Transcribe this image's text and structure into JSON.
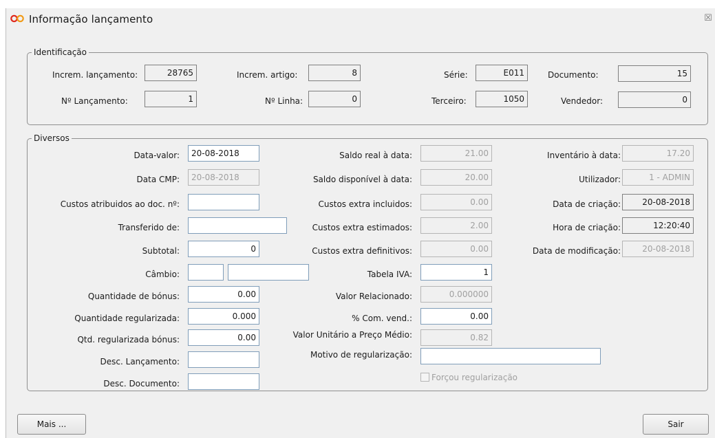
{
  "window": {
    "title": "Informação lançamento",
    "close_glyph": "☒"
  },
  "identificacao": {
    "legend": "Identificação",
    "increm_lancamento": {
      "label": "Increm. lançamento:",
      "value": "28765"
    },
    "increm_artigo": {
      "label": "Increm. artigo:",
      "value": "8"
    },
    "serie": {
      "label": "Série:",
      "value": "E011"
    },
    "documento": {
      "label": "Documento:",
      "value": "15"
    },
    "n_lancamento": {
      "label": "Nº Lançamento:",
      "value": "1"
    },
    "n_linha": {
      "label": "Nº Linha:",
      "value": "0"
    },
    "terceiro": {
      "label": "Terceiro:",
      "value": "1050"
    },
    "vendedor": {
      "label": "Vendedor:",
      "value": "0"
    }
  },
  "diversos": {
    "legend": "Diversos",
    "data_valor": {
      "label": "Data-valor:",
      "value": "20-08-2018"
    },
    "data_cmp": {
      "label": "Data CMP:",
      "value": "20-08-2018"
    },
    "custos_atribuidos": {
      "label": "Custos atribuidos ao doc. nº:",
      "value": ""
    },
    "transferido_de": {
      "label": "Transferido de:",
      "value": ""
    },
    "subtotal": {
      "label": "Subtotal:",
      "value": "0"
    },
    "cambio": {
      "label": "Câmbio:",
      "value_a": "",
      "value_b": ""
    },
    "quantidade_bonus": {
      "label": "Quantidade de bónus:",
      "value": "0.00"
    },
    "quantidade_regularizada": {
      "label": "Quantidade regularizada:",
      "value": "0.000"
    },
    "qtd_regularizada_bonus": {
      "label": "Qtd. regularizada bónus:",
      "value": "0.00"
    },
    "desc_lancamento": {
      "label": "Desc. Lançamento:",
      "value": ""
    },
    "desc_documento": {
      "label": "Desc. Documento:",
      "value": ""
    },
    "saldo_real": {
      "label": "Saldo real à data:",
      "value": "21.00"
    },
    "saldo_disponivel": {
      "label": "Saldo disponível à data:",
      "value": "20.00"
    },
    "custos_extra_incluidos": {
      "label": "Custos extra incluidos:",
      "value": "0.00"
    },
    "custos_extra_estimados": {
      "label": "Custos extra estimados:",
      "value": "2.00"
    },
    "custos_extra_definitivos": {
      "label": "Custos extra definitivos:",
      "value": "0.00"
    },
    "tabela_iva": {
      "label": "Tabela IVA:",
      "value": "1"
    },
    "valor_relacionado": {
      "label": "Valor Relacionado:",
      "value": "0.000000"
    },
    "com_vend": {
      "label": "% Com. vend.:",
      "value": "0.00"
    },
    "valor_unitario": {
      "label": "Valor Unitário a Preço Médio:",
      "value": "0.82"
    },
    "motivo_regularizacao": {
      "label": "Motivo de regularização:",
      "value": ""
    },
    "forcou_regularizacao": {
      "label": "Forçou regularização",
      "checked": false
    },
    "inventario": {
      "label": "Inventário à data:",
      "value": "17.20"
    },
    "utilizador": {
      "label": "Utilizador:",
      "value": "1 - ADMIN"
    },
    "data_criacao": {
      "label": "Data de criação:",
      "value": "20-08-2018"
    },
    "hora_criacao": {
      "label": "Hora de criação:",
      "value": "12:20:40"
    },
    "data_modificacao": {
      "label": "Data de modificação:",
      "value": "20-08-2018"
    }
  },
  "buttons": {
    "mais": "Mais ...",
    "sair": "Sair"
  },
  "icons": {
    "app": "infinity-logo-icon",
    "close": "close-icon"
  },
  "colors": {
    "accent_red": "#e0271b",
    "accent_orange": "#f19a16",
    "window_bg": "#f0f0f0"
  }
}
